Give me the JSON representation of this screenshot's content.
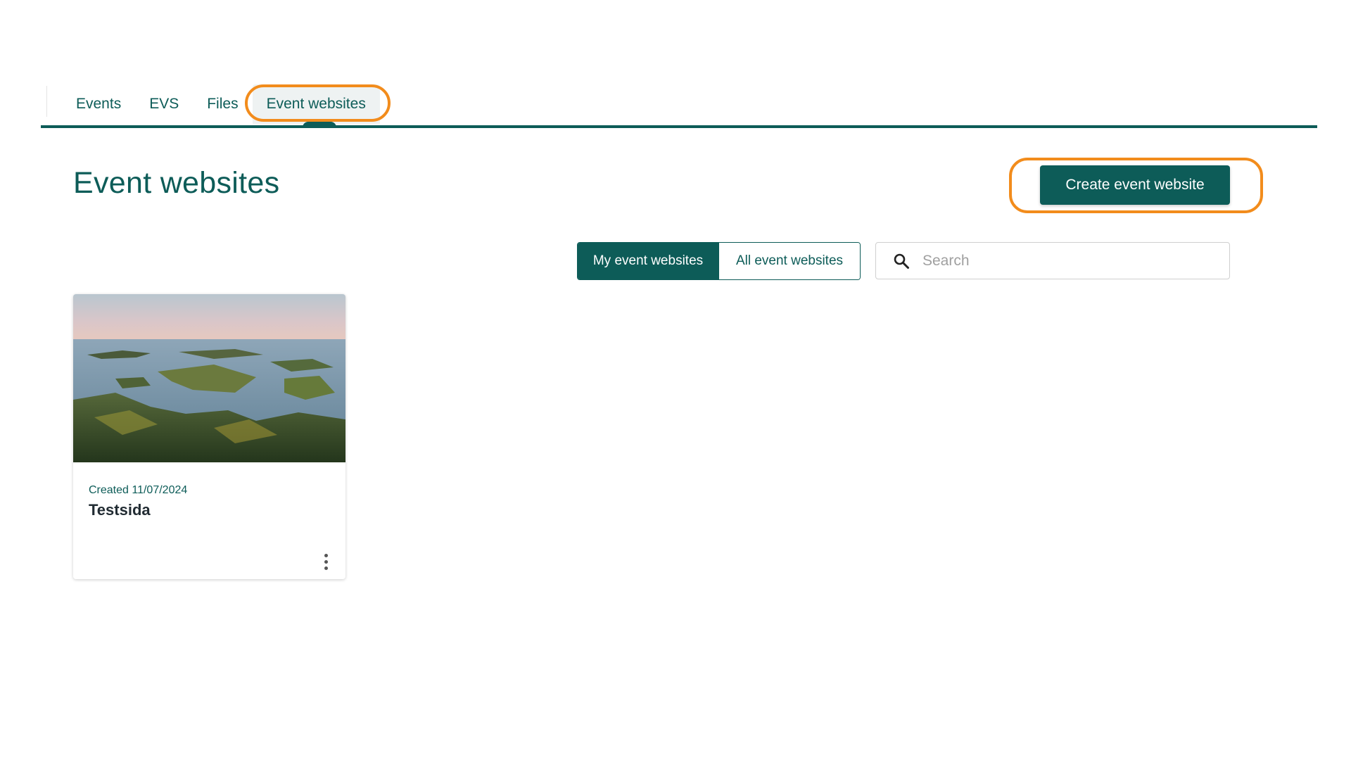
{
  "nav": {
    "tabs": [
      {
        "label": "Events"
      },
      {
        "label": "EVS"
      },
      {
        "label": "Files"
      },
      {
        "label": "Event websites",
        "active": true
      }
    ]
  },
  "header": {
    "title": "Event websites",
    "create_button": "Create event website"
  },
  "filters": {
    "toggle": [
      {
        "label": "My event websites",
        "selected": true
      },
      {
        "label": "All event websites",
        "selected": false
      }
    ],
    "search": {
      "placeholder": "Search",
      "value": ""
    }
  },
  "cards": [
    {
      "created": "Created 11/07/2024",
      "title": "Testsida",
      "image": "archipelago-landscape",
      "menu_icon": "more-vert-icon"
    }
  ],
  "colors": {
    "primary": "#0d5c58",
    "highlight": "#f28c1c",
    "tab_active_bg": "#eef2f2"
  }
}
